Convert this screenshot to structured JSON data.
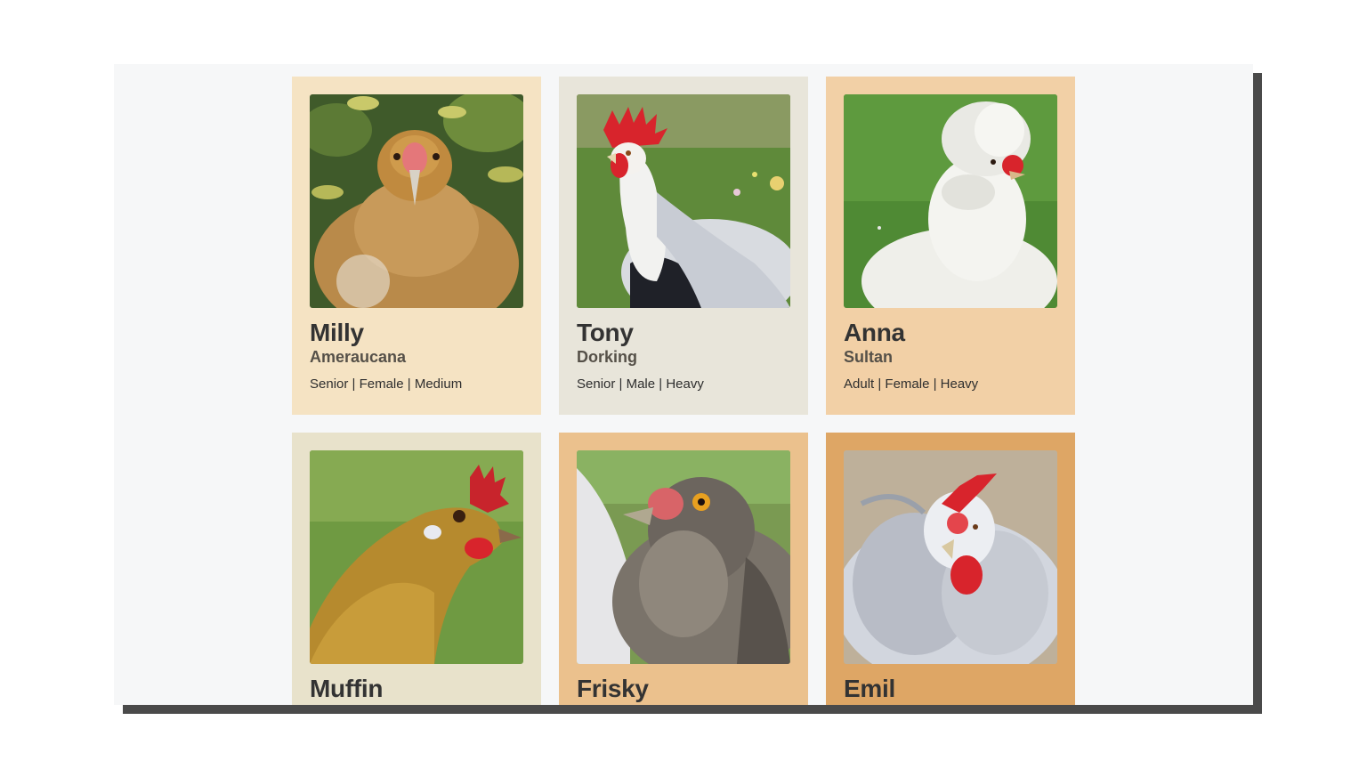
{
  "cards": [
    {
      "name": "Milly",
      "breed": "Ameraucana",
      "meta": "Senior | Female | Medium",
      "bg": "#f5e3c3"
    },
    {
      "name": "Tony",
      "breed": "Dorking",
      "meta": "Senior | Male | Heavy",
      "bg": "#e8e5da"
    },
    {
      "name": "Anna",
      "breed": "Sultan",
      "meta": "Adult | Female | Heavy",
      "bg": "#f2d0a6"
    },
    {
      "name": "Muffin",
      "breed": "",
      "meta": "",
      "bg": "#e8e2cb"
    },
    {
      "name": "Frisky",
      "breed": "",
      "meta": "",
      "bg": "#ebc18d"
    },
    {
      "name": "Emil",
      "breed": "",
      "meta": "",
      "bg": "#dea665"
    }
  ]
}
